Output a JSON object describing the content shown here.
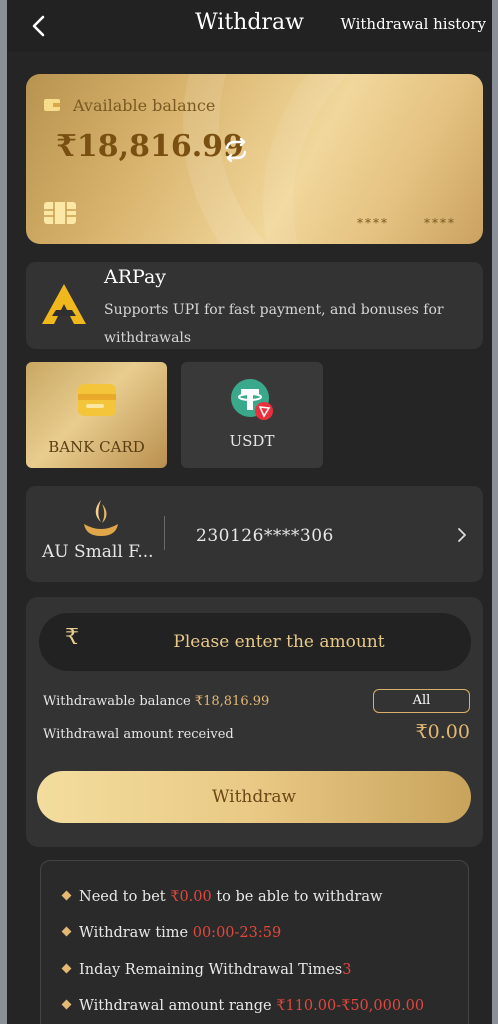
{
  "header": {
    "title": "Withdraw",
    "history_label": "Withdrawal history"
  },
  "balance_card": {
    "label": "Available balance",
    "amount": "₹18,816.99",
    "masked_1": "****",
    "masked_2": "****"
  },
  "arpay": {
    "name": "ARPay",
    "description": "Supports UPI for fast payment, and bonuses for withdrawals"
  },
  "methods": [
    {
      "label": "BANK CARD",
      "selected": true
    },
    {
      "label": "USDT",
      "selected": false
    }
  ],
  "bank": {
    "name": "AU Small F...",
    "account": "230126****306"
  },
  "amount_panel": {
    "currency_symbol": "₹",
    "placeholder": "Please enter the amount",
    "withdrawable_label": "Withdrawable balance ",
    "withdrawable_value": "₹18,816.99",
    "all_label": "All",
    "received_label": "Withdrawal amount received",
    "received_value": "₹0.00",
    "withdraw_button": "Withdraw"
  },
  "rules": [
    {
      "text": "Need to bet ",
      "highlight": "₹0.00",
      "suffix": " to be able to withdraw"
    },
    {
      "text": "Withdraw time ",
      "highlight": "00:00-23:59",
      "suffix": ""
    },
    {
      "text": "Inday Remaining Withdrawal Times",
      "highlight": "3",
      "suffix": ""
    },
    {
      "text": "Withdrawal amount range ",
      "highlight": "₹110.00-₹50,000.00",
      "suffix": ""
    }
  ],
  "colors": {
    "gold": "#e3b873",
    "red_highlight": "#e0483e",
    "panel": "#333333",
    "background": "#252525"
  }
}
